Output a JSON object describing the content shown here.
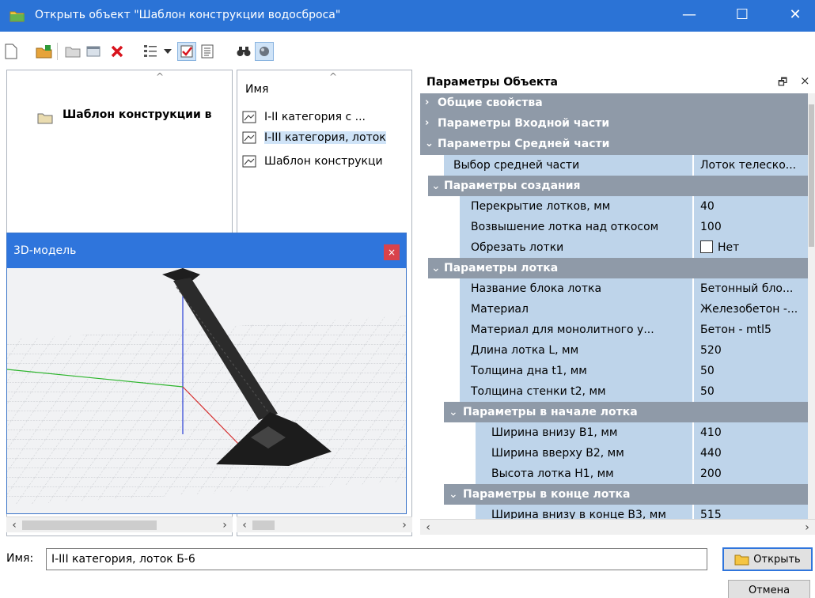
{
  "window": {
    "title": "Открыть объект \"Шаблон конструкции водосброса\"",
    "minimize": "—",
    "maximize": "☐",
    "close": "✕"
  },
  "tree": {
    "sort_arrow": "^",
    "items": [
      {
        "label": "Шаблон конструкции в"
      }
    ]
  },
  "list": {
    "sort_arrow": "^",
    "column_header": "Имя",
    "items": [
      {
        "label": "I-II категория с ..."
      },
      {
        "label": "I-III категория, лоток"
      },
      {
        "label": "Шаблон конструкци"
      }
    ]
  },
  "model_window": {
    "title": "3D-модель",
    "close": "×"
  },
  "properties": {
    "title": "Параметры Объекта",
    "pin": "🗗",
    "close": "×",
    "groups": {
      "general": "Общие свойства",
      "inlet": "Параметры Входной части",
      "middle": "Параметры Средней части"
    },
    "toggles": {
      "collapsed": "›",
      "expanded": "⌄"
    },
    "middle_choice": {
      "label": "Выбор средней части",
      "value": "Лоток телеско..."
    },
    "creation": {
      "label": "Параметры создания",
      "rows": [
        {
          "label": "Перекрытие лотков, мм",
          "value": "40"
        },
        {
          "label": "Возвышение лотка над откосом",
          "value": "100"
        }
      ],
      "cut": {
        "label": "Обрезать лотки",
        "value": "Нет"
      }
    },
    "tray": {
      "label": "Параметры лотка",
      "rows": [
        {
          "label": "Название блока лотка",
          "value": "Бетонный бло..."
        },
        {
          "label": "Материал",
          "value": "Железобетон -..."
        },
        {
          "label": "Материал для монолитного у...",
          "value": "Бетон - mtl5"
        },
        {
          "label": "Длина лотка L, мм",
          "value": "520"
        },
        {
          "label": "Толщина дна t1, мм",
          "value": "50"
        },
        {
          "label": "Толщина стенки t2, мм",
          "value": "50"
        }
      ]
    },
    "tray_start": {
      "label": "Параметры в начале лотка",
      "rows": [
        {
          "label": "Ширина внизу B1, мм",
          "value": "410"
        },
        {
          "label": "Ширина вверху B2, мм",
          "value": "440"
        },
        {
          "label": "Высота лотка H1, мм",
          "value": "200"
        }
      ]
    },
    "tray_end": {
      "label": "Параметры в конце лотка",
      "rows": [
        {
          "label": "Ширина внизу в конце B3, мм",
          "value": "515"
        }
      ]
    }
  },
  "footer": {
    "name_label": "Имя:",
    "name_value": "I-III категория, лоток Б-6",
    "open_button": "Открыть",
    "cancel_button": "Отмена"
  },
  "colors": {
    "titlebar": "#2b73d6",
    "group_header": "#8f9aa8",
    "property_cell": "#bed4ea",
    "delete_red": "#d8131d"
  }
}
